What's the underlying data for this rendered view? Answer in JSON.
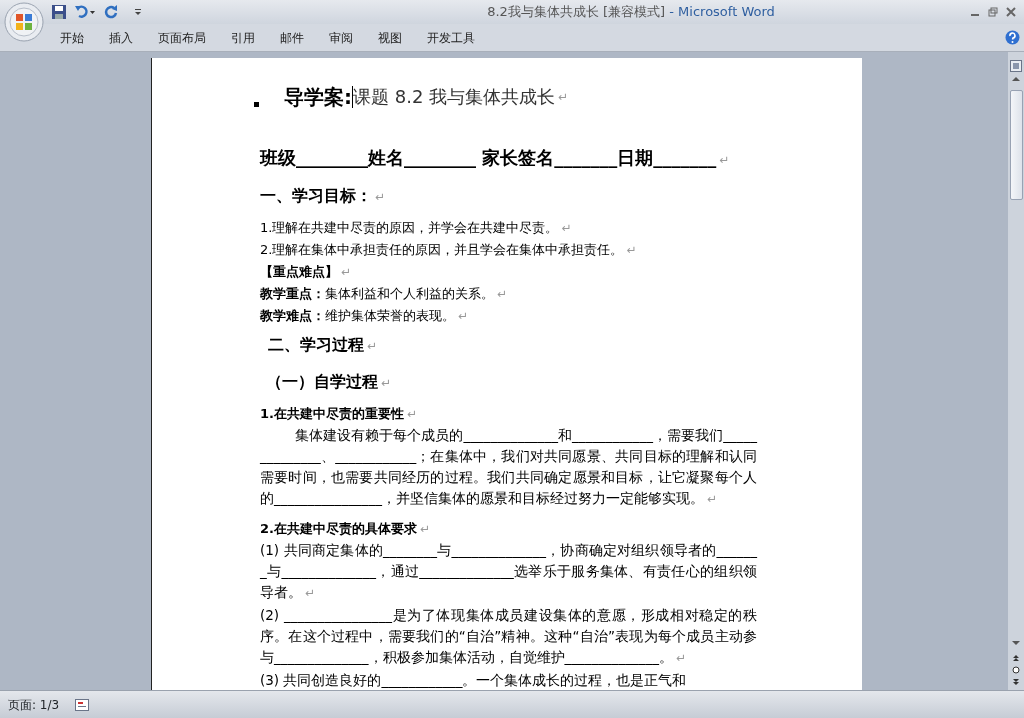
{
  "window": {
    "title": "8.2我与集体共成长 [兼容模式]",
    "app": "- Microsoft Word"
  },
  "tabs": [
    {
      "label": "开始"
    },
    {
      "label": "插入"
    },
    {
      "label": "页面布局"
    },
    {
      "label": "引用"
    },
    {
      "label": "邮件"
    },
    {
      "label": "审阅"
    },
    {
      "label": "视图"
    },
    {
      "label": "开发工具"
    }
  ],
  "document": {
    "paragraphs": [
      {
        "kind": "title",
        "text": "导学案:",
        "subtitle": "课题 8.2 我与集体共成长",
        "mark": "↵"
      },
      {
        "kind": "fields",
        "text": "班级________姓名________ 家长签名_______日期_______",
        "mark": "↵"
      },
      {
        "kind": "h1",
        "text": "一、学习目标：",
        "mark": "↵"
      },
      {
        "kind": "line",
        "text": "1.理解在共建中尽责的原因，并学会在共建中尽责。",
        "mark": "↵"
      },
      {
        "kind": "line",
        "text": "2.理解在集体中承担责任的原因，并且学会在集体中承担责任。",
        "mark": "↵"
      },
      {
        "kind": "line",
        "text": "**【重点难点】**",
        "mark": "↵"
      },
      {
        "kind": "line",
        "text": "**教学重点：**集体利益和个人利益的关系。",
        "mark": "↵"
      },
      {
        "kind": "line",
        "text": "**教学难点：**维护集体荣誉的表现。",
        "mark": "↵"
      },
      {
        "kind": "h2",
        "text": "二、学习过程",
        "mark": "↵"
      },
      {
        "kind": "h3",
        "text": "（一）自学过程",
        "mark": "↵"
      },
      {
        "kind": "sub",
        "text": "1.在共建中尽责的重要性",
        "mark": "↵"
      },
      {
        "kind": "body",
        "indent": true,
        "text": "集体建设有赖于每个成员的______________和____________，需要我们______________、____________；在集体中，我们对共同愿景、共同目标的理解和认同需要时间，也需要共同经历的过程。我们共同确定愿景和目标，让它凝聚每个人的________________，并坚信集体的愿景和目标经过努力一定能够实现。",
        "mark": "↵"
      },
      {
        "kind": "sub",
        "text": "2.在共建中尽责的具体要求",
        "mark": "↵"
      },
      {
        "kind": "body",
        "indent": false,
        "text": "(1) 共同商定集体的________与______________，协商确定对组织领导者的_______与______________，通过______________选举乐于服务集体、有责任心的组织领导者。",
        "mark": "↵"
      },
      {
        "kind": "body",
        "indent": false,
        "text": "(2) ________________是为了体现集体成员建设集体的意愿，形成相对稳定的秩序。在这个过程中，需要我们的“自治”精神。这种“自治”表现为每个成员主动参与______________，积极参加集体活动，自觉维护______________。",
        "mark": "↵"
      },
      {
        "kind": "body",
        "indent": false,
        "text": "(3) 共同创造良好的____________。一个集体成长的过程，也是正气和"
      }
    ]
  },
  "status_bar": {
    "page": "页面: 1/3"
  }
}
